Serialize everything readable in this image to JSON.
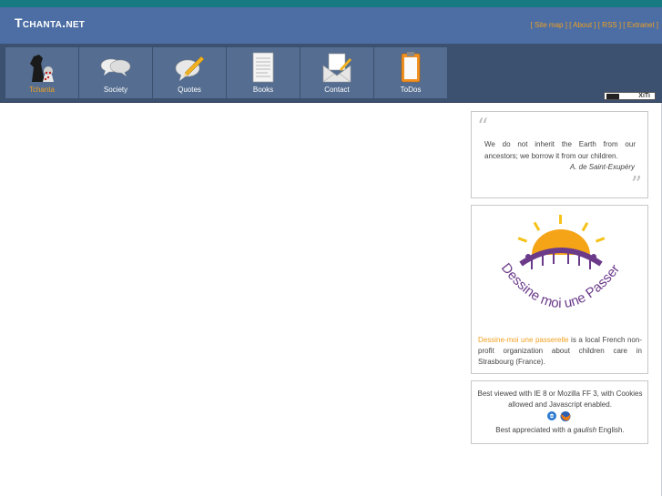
{
  "header": {
    "site_title": "Tchanta.net",
    "links": [
      "Site map",
      "About",
      "RSS",
      "Extranet"
    ],
    "accent_color": "#f0a020",
    "bar_color": "#4c6ea4"
  },
  "nav": {
    "items": [
      {
        "label": "Tchanta",
        "icon": "chess-pieces-icon",
        "active": true
      },
      {
        "label": "Society",
        "icon": "speech-bubbles-icon",
        "active": false
      },
      {
        "label": "Quotes",
        "icon": "pencil-bubble-icon",
        "active": false
      },
      {
        "label": "Books",
        "icon": "document-page-icon",
        "active": false
      },
      {
        "label": "Contact",
        "icon": "envelope-icon",
        "active": false
      },
      {
        "label": "ToDos",
        "icon": "clipboard-icon",
        "active": false
      }
    ],
    "xiti_label": "XiTi"
  },
  "sidebar": {
    "quote": {
      "text": "We do not inherit the Earth from our ancestors; we borrow it from our children.",
      "author": "A. de Saint-Exupéry"
    },
    "dmp": {
      "logo_text": "Dessine moi une Passerelle",
      "link_text": "Dessine-moi une passerelle",
      "description": " is a local French non-profit organization about children care in Strasbourg (France)."
    },
    "best_viewed": {
      "line1": "Best viewed with IE 8 or Mozilla FF 3, with Cookies allowed and Javascript enabled.",
      "line2_prefix": "Best appreciated with a ",
      "line2_em": "gaulish",
      "line2_suffix": " English.",
      "icons": [
        "ie-browser-icon",
        "firefox-browser-icon"
      ]
    }
  }
}
